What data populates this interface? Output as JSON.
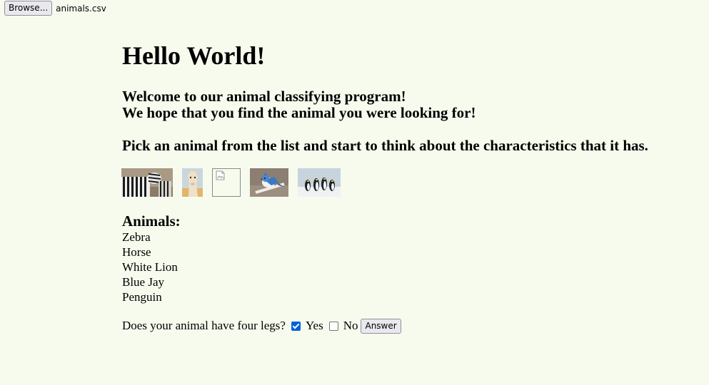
{
  "file_input": {
    "button_label": "Browse...",
    "file_name": "animals.csv"
  },
  "page": {
    "title": "Hello World!",
    "welcome_line1": "Welcome to our animal classifying program!",
    "welcome_line2": "We hope that you find the animal you were looking for!",
    "instruction": "Pick an animal from the list and start to think about the characteristics that it has."
  },
  "images": [
    {
      "name": "zebra-image",
      "broken": false
    },
    {
      "name": "horse-image",
      "broken": false
    },
    {
      "name": "white-lion-image",
      "broken": true
    },
    {
      "name": "blue-jay-image",
      "broken": false
    },
    {
      "name": "penguin-image",
      "broken": false
    }
  ],
  "animals": {
    "heading": "Animals:",
    "items": [
      "Zebra",
      "Horse",
      "White Lion",
      "Blue Jay",
      "Penguin"
    ]
  },
  "question": {
    "text": "Does your animal have four legs?",
    "yes_label": "Yes",
    "yes_checked": true,
    "no_label": "No",
    "no_checked": false,
    "answer_label": "Answer"
  },
  "colors": {
    "background": "#f7fbee",
    "checkbox_checked": "#0060df"
  }
}
